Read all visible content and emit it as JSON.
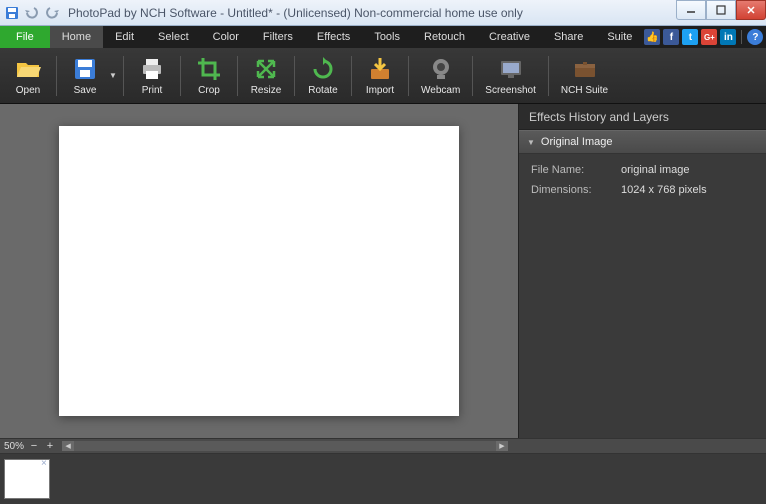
{
  "window": {
    "title": "PhotoPad by NCH Software - Untitled* - (Unlicensed) Non-commercial home use only"
  },
  "menu": {
    "file": "File",
    "home": "Home",
    "edit": "Edit",
    "select": "Select",
    "color": "Color",
    "filters": "Filters",
    "effects": "Effects",
    "tools": "Tools",
    "retouch": "Retouch",
    "creative": "Creative",
    "share": "Share",
    "suite": "Suite"
  },
  "social": {
    "like": "👍",
    "fb": "f",
    "tw": "t",
    "gp": "G+",
    "in": "in",
    "help": "?"
  },
  "toolbar": {
    "open": "Open",
    "save": "Save",
    "print": "Print",
    "crop": "Crop",
    "resize": "Resize",
    "rotate": "Rotate",
    "import": "Import",
    "webcam": "Webcam",
    "screenshot": "Screenshot",
    "suite": "NCH Suite"
  },
  "panel": {
    "title": "Effects History and Layers",
    "section": "Original Image",
    "rows": [
      {
        "label": "File Name:",
        "value": "original image"
      },
      {
        "label": "Dimensions:",
        "value": "1024 x 768 pixels"
      }
    ]
  },
  "status": {
    "zoom": "50%"
  }
}
